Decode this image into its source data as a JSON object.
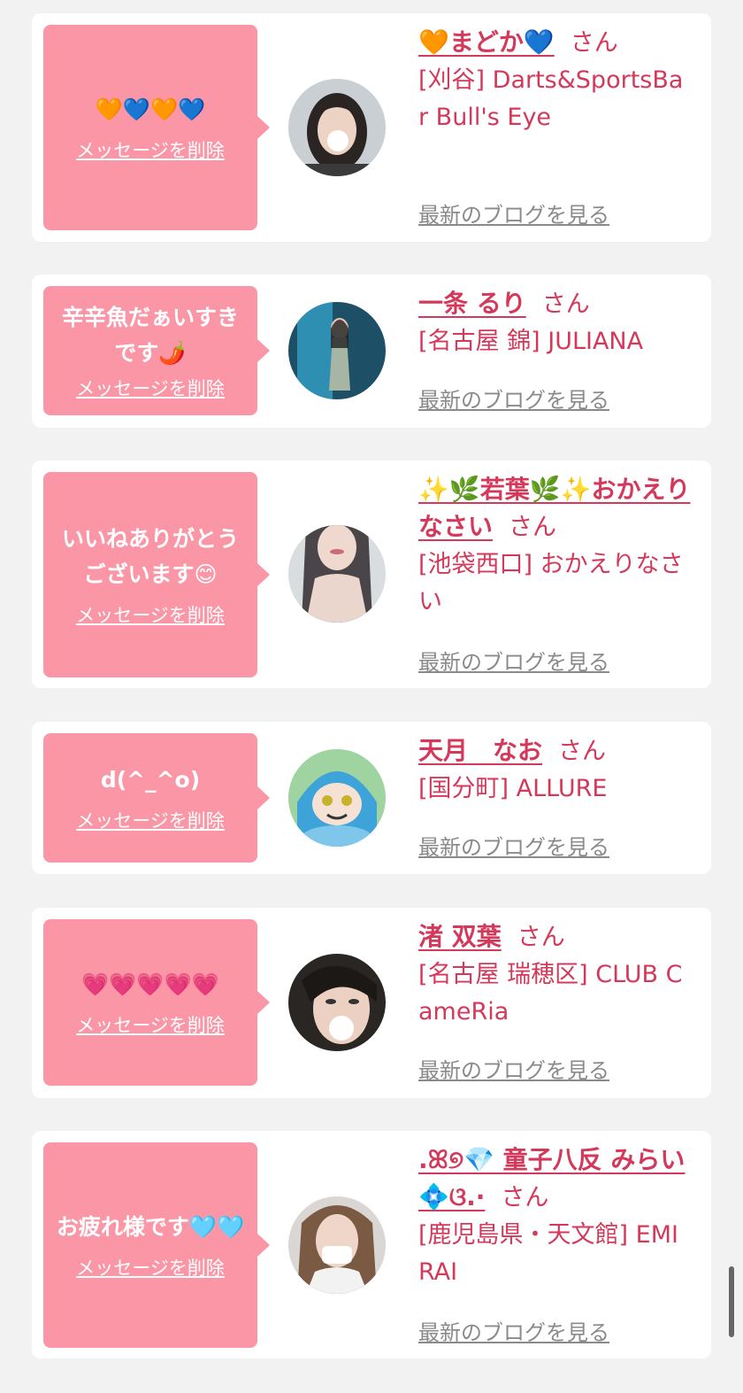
{
  "common": {
    "delete_label": "メッセージを削除",
    "blog_label": "最新のブログを見る",
    "honorific": "さん"
  },
  "colors": {
    "bubble": "#fa96a6",
    "name": "#d4385a",
    "link_gray": "#8a8a8a",
    "background": "#f2f2f2"
  },
  "messages": [
    {
      "message": "🧡💙🧡💙",
      "name": "🧡まどか💙",
      "store": "[刈谷] Darts&SportsBar Bull's Eye"
    },
    {
      "message": "辛辛魚だぁいすきです🌶️",
      "name": "一条 るり",
      "store": "[名古屋 錦] JULIANA"
    },
    {
      "message": "いいねありがとうございます😊",
      "name": "✨🌿若葉🌿✨おかえりなさい",
      "store": "[池袋西口] おかえりなさい"
    },
    {
      "message": "d(^_^o)",
      "name": "天月　なお",
      "store": "[国分町] ALLURE"
    },
    {
      "message": "💗💗💗💗💗",
      "name": "渚 双葉",
      "store": "[名古屋 瑞穂区] CLUB CameRia"
    },
    {
      "message": "お疲れ様です🩵🩵",
      "name": ".ꕤ୭💎 童子八反 みらい💠ଓ.·",
      "store": "[鹿児島県・天文館] EMIRAI"
    }
  ]
}
